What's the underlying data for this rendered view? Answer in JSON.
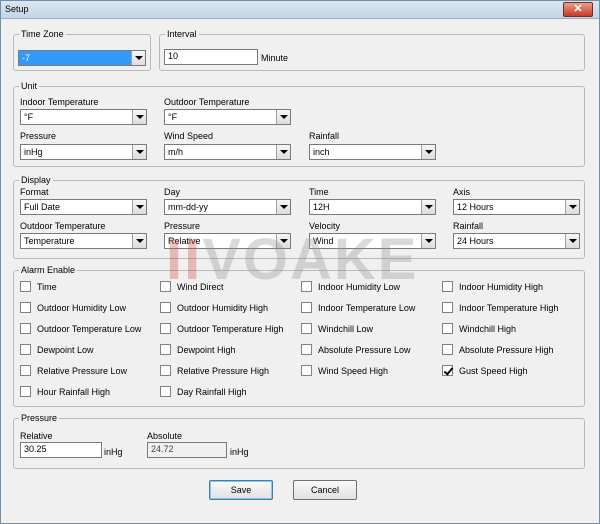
{
  "window": {
    "title": "Setup",
    "close_glyph": "✕"
  },
  "time_zone": {
    "legend": "Time Zone",
    "value": "-7"
  },
  "interval": {
    "legend": "Interval",
    "value": "10",
    "unit": "Minute"
  },
  "unit": {
    "legend": "Unit",
    "indoor_temperature": {
      "label": "Indoor Temperature",
      "value": "°F"
    },
    "outdoor_temperature": {
      "label": "Outdoor Temperature",
      "value": "°F"
    },
    "pressure": {
      "label": "Pressure",
      "value": "inHg"
    },
    "wind_speed": {
      "label": "Wind Speed",
      "value": "m/h"
    },
    "rainfall": {
      "label": "Rainfall",
      "value": "inch"
    }
  },
  "display": {
    "legend": "Display",
    "format": {
      "label": "Format",
      "value": "Full Date"
    },
    "day": {
      "label": "Day",
      "value": "mm-dd-yy"
    },
    "time": {
      "label": "Time",
      "value": "12H"
    },
    "axis": {
      "label": "Axis",
      "value": "12 Hours"
    },
    "outdoor_temperature": {
      "label": "Outdoor Temperature",
      "value": "Temperature"
    },
    "pressure": {
      "label": "Pressure",
      "value": "Relative"
    },
    "velocity": {
      "label": "Velocity",
      "value": "Wind"
    },
    "rainfall": {
      "label": "Rainfall",
      "value": "24 Hours"
    }
  },
  "alarm": {
    "legend": "Alarm Enable",
    "items": [
      {
        "label": "Time",
        "checked": false
      },
      {
        "label": "Wind Direct",
        "checked": false
      },
      {
        "label": "Indoor Humidity Low",
        "checked": false
      },
      {
        "label": "Indoor Humidity High",
        "checked": false
      },
      {
        "label": "Outdoor Humidity Low",
        "checked": false
      },
      {
        "label": "Outdoor Humidity High",
        "checked": false
      },
      {
        "label": "Indoor Temperature Low",
        "checked": false
      },
      {
        "label": "Indoor Temperature High",
        "checked": false
      },
      {
        "label": "Outdoor Temperature Low",
        "checked": false
      },
      {
        "label": "Outdoor Temperature High",
        "checked": false
      },
      {
        "label": "Windchill Low",
        "checked": false
      },
      {
        "label": "Windchill High",
        "checked": false
      },
      {
        "label": "Dewpoint Low",
        "checked": false
      },
      {
        "label": "Dewpoint High",
        "checked": false
      },
      {
        "label": "Absolute Pressure Low",
        "checked": false
      },
      {
        "label": "Absolute Pressure High",
        "checked": false
      },
      {
        "label": "Relative Pressure Low",
        "checked": false
      },
      {
        "label": "Relative Pressure High",
        "checked": false
      },
      {
        "label": "Wind Speed High",
        "checked": false
      },
      {
        "label": "Gust Speed High",
        "checked": true
      },
      {
        "label": "Hour Rainfall High",
        "checked": false
      },
      {
        "label": "Day Rainfall High",
        "checked": false
      }
    ]
  },
  "pressure": {
    "legend": "Pressure",
    "relative": {
      "label": "Relative",
      "value": "30.25",
      "unit": "inHg"
    },
    "absolute": {
      "label": "Absolute",
      "value": "24.72",
      "unit": "inHg"
    }
  },
  "buttons": {
    "save": "Save",
    "cancel": "Cancel"
  },
  "watermark": {
    "mark": "II",
    "text": "VOAKE"
  }
}
